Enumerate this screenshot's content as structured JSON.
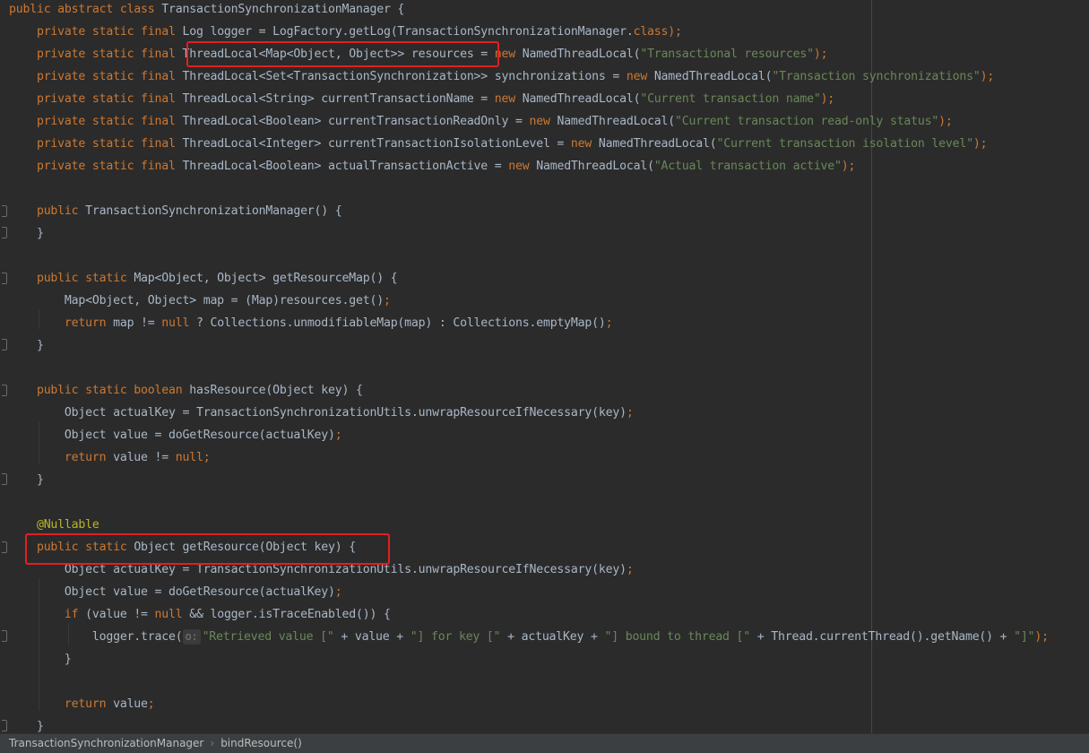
{
  "editor": {
    "lines": [
      [
        {
          "t": "public abstract class ",
          "c": "kw"
        },
        {
          "t": "TransactionSynchronizationManager {",
          "c": "plain"
        }
      ],
      [
        {
          "t": "    private static final ",
          "c": "kw"
        },
        {
          "t": "Log logger = LogFactory.",
          "c": "plain"
        },
        {
          "t": "getLog",
          "c": "plain"
        },
        {
          "t": "(TransactionSynchronizationManager.",
          "c": "plain"
        },
        {
          "t": "class",
          "c": "kw"
        },
        {
          "t": ");",
          "c": "kw"
        }
      ],
      [
        {
          "t": "    private static final ",
          "c": "kw"
        },
        {
          "t": "ThreadLocal<Map<Object, Object>> resources = ",
          "c": "plain"
        },
        {
          "t": "new ",
          "c": "kw"
        },
        {
          "t": "NamedThreadLocal(",
          "c": "plain"
        },
        {
          "t": "\"Transactional resources\"",
          "c": "str"
        },
        {
          "t": ");",
          "c": "kw"
        }
      ],
      [
        {
          "t": "    private static final ",
          "c": "kw"
        },
        {
          "t": "ThreadLocal<Set<TransactionSynchronization>> synchronizations = ",
          "c": "plain"
        },
        {
          "t": "new ",
          "c": "kw"
        },
        {
          "t": "NamedThreadLocal(",
          "c": "plain"
        },
        {
          "t": "\"Transaction synchronizations\"",
          "c": "str"
        },
        {
          "t": ");",
          "c": "kw"
        }
      ],
      [
        {
          "t": "    private static final ",
          "c": "kw"
        },
        {
          "t": "ThreadLocal<String> currentTransactionName = ",
          "c": "plain"
        },
        {
          "t": "new ",
          "c": "kw"
        },
        {
          "t": "NamedThreadLocal(",
          "c": "plain"
        },
        {
          "t": "\"Current transaction name\"",
          "c": "str"
        },
        {
          "t": ");",
          "c": "kw"
        }
      ],
      [
        {
          "t": "    private static final ",
          "c": "kw"
        },
        {
          "t": "ThreadLocal<Boolean> currentTransactionReadOnly = ",
          "c": "plain"
        },
        {
          "t": "new ",
          "c": "kw"
        },
        {
          "t": "NamedThreadLocal(",
          "c": "plain"
        },
        {
          "t": "\"Current transaction read-only status\"",
          "c": "str"
        },
        {
          "t": ");",
          "c": "kw"
        }
      ],
      [
        {
          "t": "    private static final ",
          "c": "kw"
        },
        {
          "t": "ThreadLocal<Integer> currentTransactionIsolationLevel = ",
          "c": "plain"
        },
        {
          "t": "new ",
          "c": "kw"
        },
        {
          "t": "NamedThreadLocal(",
          "c": "plain"
        },
        {
          "t": "\"Current transaction isolation level\"",
          "c": "str"
        },
        {
          "t": ");",
          "c": "kw"
        }
      ],
      [
        {
          "t": "    private static final ",
          "c": "kw"
        },
        {
          "t": "ThreadLocal<Boolean> actualTransactionActive = ",
          "c": "plain"
        },
        {
          "t": "new ",
          "c": "kw"
        },
        {
          "t": "NamedThreadLocal(",
          "c": "plain"
        },
        {
          "t": "\"Actual transaction active\"",
          "c": "str"
        },
        {
          "t": ");",
          "c": "kw"
        }
      ],
      [],
      [
        {
          "t": "    public ",
          "c": "kw"
        },
        {
          "t": "TransactionSynchronizationManager() {",
          "c": "plain"
        }
      ],
      [
        {
          "t": "    }",
          "c": "plain"
        }
      ],
      [],
      [
        {
          "t": "    public static ",
          "c": "kw"
        },
        {
          "t": "Map<Object, Object> getResourceMap() {",
          "c": "plain"
        }
      ],
      [
        {
          "t": "        Map<Object, Object> map = (Map)resources.get()",
          "c": "plain"
        },
        {
          "t": ";",
          "c": "kw"
        }
      ],
      [
        {
          "t": "        return ",
          "c": "kw"
        },
        {
          "t": "map != ",
          "c": "plain"
        },
        {
          "t": "null ",
          "c": "kw"
        },
        {
          "t": "? Collections.unmodifiableMap(map) : Collections.emptyMap()",
          "c": "plain"
        },
        {
          "t": ";",
          "c": "kw"
        }
      ],
      [
        {
          "t": "    }",
          "c": "plain"
        }
      ],
      [],
      [
        {
          "t": "    public static boolean ",
          "c": "kw"
        },
        {
          "t": "hasResource(Object key) {",
          "c": "plain"
        }
      ],
      [
        {
          "t": "        Object actualKey = TransactionSynchronizationUtils.unwrapResourceIfNecessary(key)",
          "c": "plain"
        },
        {
          "t": ";",
          "c": "kw"
        }
      ],
      [
        {
          "t": "        Object value = doGetResource(actualKey)",
          "c": "plain"
        },
        {
          "t": ";",
          "c": "kw"
        }
      ],
      [
        {
          "t": "        return ",
          "c": "kw"
        },
        {
          "t": "value != ",
          "c": "plain"
        },
        {
          "t": "null;",
          "c": "kw"
        }
      ],
      [
        {
          "t": "    }",
          "c": "plain"
        }
      ],
      [],
      [
        {
          "t": "    @Nullable",
          "c": "ann"
        }
      ],
      [
        {
          "t": "    public static ",
          "c": "kw"
        },
        {
          "t": "Object getResource(Object key) {",
          "c": "plain"
        }
      ],
      [
        {
          "t": "        Object actualKey = TransactionSynchronizationUtils.unwrapResourceIfNecessary(key)",
          "c": "plain"
        },
        {
          "t": ";",
          "c": "kw"
        }
      ],
      [
        {
          "t": "        Object value = doGetResource(actualKey)",
          "c": "plain"
        },
        {
          "t": ";",
          "c": "kw"
        }
      ],
      [
        {
          "t": "        if ",
          "c": "kw"
        },
        {
          "t": "(value != ",
          "c": "plain"
        },
        {
          "t": "null ",
          "c": "kw"
        },
        {
          "t": "&& logger.isTraceEnabled()) {",
          "c": "plain"
        }
      ],
      [
        {
          "t": "            logger.trace(",
          "c": "plain"
        },
        {
          "t": "o:",
          "c": "hint"
        },
        {
          "t": "\"Retrieved value [\" ",
          "c": "str"
        },
        {
          "t": "+ value + ",
          "c": "plain"
        },
        {
          "t": "\"] for key [\" ",
          "c": "str"
        },
        {
          "t": "+ actualKey + ",
          "c": "plain"
        },
        {
          "t": "\"] bound to thread [\" ",
          "c": "str"
        },
        {
          "t": "+ Thread.currentThread().getName() + ",
          "c": "plain"
        },
        {
          "t": "\"]\"",
          "c": "str"
        },
        {
          "t": ");",
          "c": "kw"
        }
      ],
      [
        {
          "t": "        }",
          "c": "plain"
        }
      ],
      [],
      [
        {
          "t": "        return ",
          "c": "kw"
        },
        {
          "t": "value",
          "c": "plain"
        },
        {
          "t": ";",
          "c": "kw"
        }
      ],
      [
        {
          "t": "    }",
          "c": "plain"
        }
      ]
    ],
    "colors": {
      "background": "#2b2b2b",
      "keyword": "#cc7832",
      "string": "#6a8759",
      "text": "#a9b7c6",
      "annotation": "#bbb529",
      "highlight_box": "#e02020"
    }
  },
  "breadcrumb": {
    "class_name": "TransactionSynchronizationManager",
    "separator": "›",
    "method_name": "bindResource()"
  }
}
